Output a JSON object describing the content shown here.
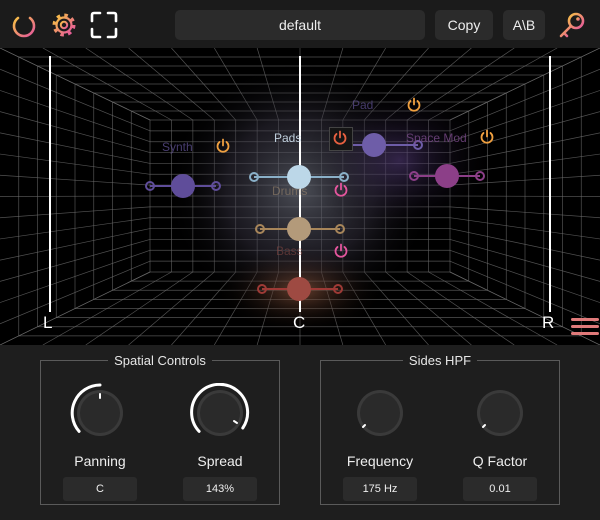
{
  "header": {
    "preset_name": "default",
    "copy_label": "Copy",
    "ab_label": "A\\B",
    "icons": [
      "power-icon",
      "gear-icon",
      "fullscreen-icon",
      "key-icon"
    ],
    "accent_gradient": [
      "#f7c244",
      "#e5569e"
    ]
  },
  "stage": {
    "left_label": "L",
    "center_label": "C",
    "right_label": "R",
    "nodes": [
      {
        "name": "Pads",
        "label": "Pads",
        "color": "#bcd7e8"
      },
      {
        "name": "Synth",
        "label": "Synth",
        "color": "#5f4d9a"
      },
      {
        "name": "Pad",
        "label": "Pad",
        "color": "#6e5da8"
      },
      {
        "name": "Space Mod",
        "label": "Space Mod",
        "color": "#8c3f88"
      },
      {
        "name": "Drums",
        "label": "Drums",
        "color": "#b39a7a"
      },
      {
        "name": "Bass",
        "label": "Bass",
        "color": "#9e4a42"
      }
    ]
  },
  "spatial": {
    "title": "Spatial Controls",
    "panning": {
      "label": "Panning",
      "value": "C"
    },
    "spread": {
      "label": "Spread",
      "value": "143%"
    }
  },
  "hpf": {
    "title": "Sides HPF",
    "frequency": {
      "label": "Frequency",
      "value": "175 Hz"
    },
    "q": {
      "label": "Q Factor",
      "value": "0.01"
    }
  }
}
